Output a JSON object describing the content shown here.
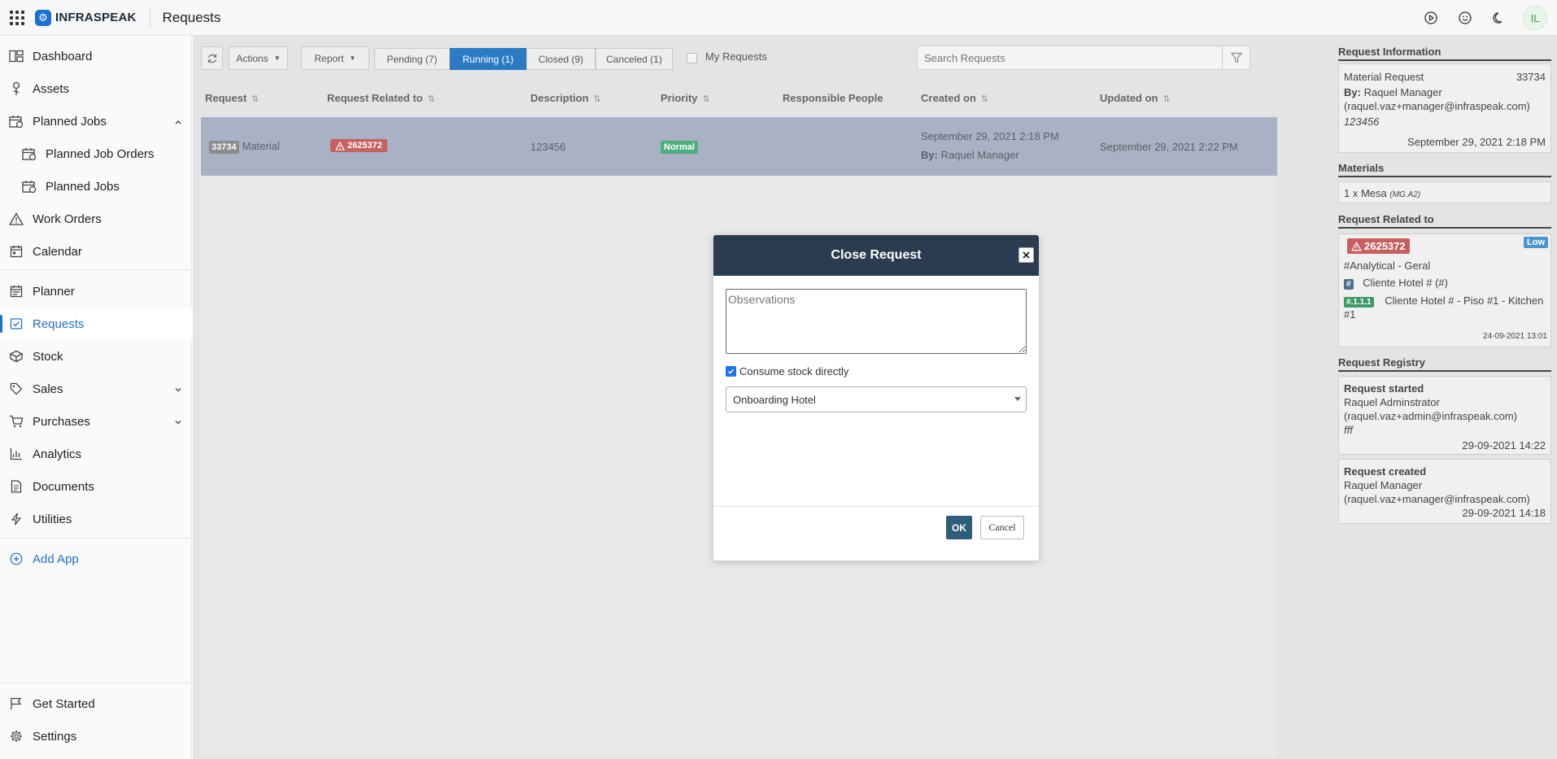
{
  "app": {
    "logo_text": "INFRASPEAK",
    "logo_mark": "⚙",
    "page_title": "Requests",
    "avatar_initials": "IL"
  },
  "sidebar": {
    "items": [
      {
        "label": "Dashboard",
        "icon": "dashboard-icon"
      },
      {
        "label": "Assets",
        "icon": "assets-icon"
      },
      {
        "label": "Planned Jobs",
        "icon": "planned-jobs-icon"
      },
      {
        "label": "Planned Job Orders",
        "icon": "planned-job-orders-icon"
      },
      {
        "label": "Planned Jobs",
        "icon": "planned-jobs-sub-icon"
      },
      {
        "label": "Work Orders",
        "icon": "warning-icon"
      },
      {
        "label": "Calendar",
        "icon": "calendar-icon"
      },
      {
        "label": "Planner",
        "icon": "planner-icon"
      },
      {
        "label": "Requests",
        "icon": "requests-icon"
      },
      {
        "label": "Stock",
        "icon": "stock-icon"
      },
      {
        "label": "Sales",
        "icon": "tag-icon"
      },
      {
        "label": "Purchases",
        "icon": "cart-icon"
      },
      {
        "label": "Analytics",
        "icon": "analytics-icon"
      },
      {
        "label": "Documents",
        "icon": "document-icon"
      },
      {
        "label": "Utilities",
        "icon": "bolt-icon"
      },
      {
        "label": "Add App",
        "icon": "plus-circle-icon"
      },
      {
        "label": "Get Started",
        "icon": "flag-icon"
      },
      {
        "label": "Settings",
        "icon": "gear-icon"
      }
    ]
  },
  "toolbar": {
    "actions_label": "Actions",
    "report_label": "Report",
    "tabs": [
      {
        "label": "Pending (7)"
      },
      {
        "label": "Running (1)"
      },
      {
        "label": "Closed (9)"
      },
      {
        "label": "Canceled (1)"
      }
    ],
    "my_requests_label": "My Requests",
    "search_placeholder": "Search Requests"
  },
  "table": {
    "columns": [
      "Request",
      "Request Related to",
      "Description",
      "Priority",
      "Responsible People",
      "Created on",
      "Updated on"
    ],
    "rows": [
      {
        "id": "33734",
        "type": "Material",
        "related": "2625372",
        "description": "123456",
        "priority": "Normal",
        "responsible": "",
        "created_on": "September 29, 2021 2:18 PM",
        "created_by_label": "By:",
        "created_by": "Raquel Manager",
        "updated_on": "September 29, 2021 2:22 PM"
      }
    ]
  },
  "right_panel": {
    "info_title": "Request Information",
    "info": {
      "type": "Material Request",
      "id": "33734",
      "by_label": "By:",
      "by": "Raquel Manager",
      "email": "(raquel.vaz+manager@infraspeak.com)",
      "description": "123456",
      "date": "September 29, 2021 2:18 PM"
    },
    "materials_title": "Materials",
    "materials": [
      {
        "text": "1 x Mesa",
        "code": "(MG.A2)"
      }
    ],
    "related_title": "Request Related to",
    "related": {
      "id": "2625372",
      "priority": "Low",
      "category": "#Analytical - Geral",
      "tag1": "#",
      "location1": "Cliente Hotel # (#)",
      "tag2": "#.1.1.1",
      "location2_a": "Cliente Hotel # - Piso #1 - Kitchen",
      "location2_b": "#1",
      "date": "24-09-2021 13:01"
    },
    "registry_title": "Request Registry",
    "registry": [
      {
        "title": "Request started",
        "user": "Raquel Adminstrator",
        "email": "(raquel.vaz+admin@infraspeak.com)",
        "note": "fff",
        "date": "29-09-2021 14:22"
      },
      {
        "title": "Request created",
        "user": "Raquel Manager",
        "email": "(raquel.vaz+manager@infraspeak.com)",
        "note": "",
        "date": "29-09-2021 14:18"
      }
    ]
  },
  "modal": {
    "title": "Close Request",
    "observations_placeholder": "Observations",
    "consume_label": "Consume stock directly",
    "warehouse_selected": "Onboarding Hotel",
    "ok_label": "OK",
    "cancel_label": "Cancel"
  },
  "colors": {
    "accent": "#1f6fd1",
    "running_tab": "#2b7bc4",
    "modal_header": "#2b3c50",
    "selected_row": "#a8b2c4",
    "danger_badge": "#c76060",
    "normal_badge": "#4fae7e",
    "low_badge": "#4b96d0",
    "ok_button": "#2e5d7a"
  }
}
